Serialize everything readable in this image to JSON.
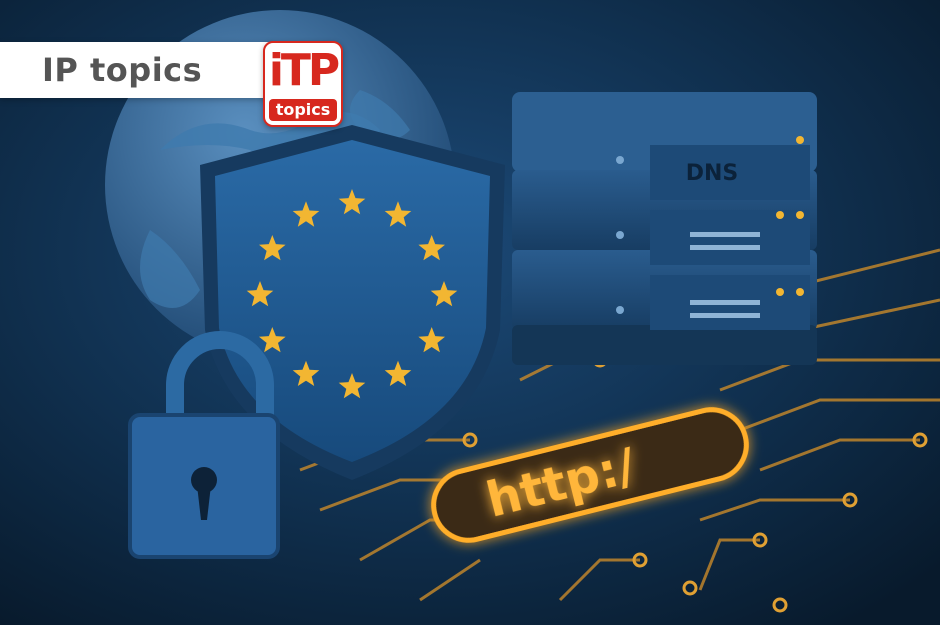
{
  "brand": {
    "title": "IP topics",
    "logo_mark": "iTP",
    "logo_word": "topics"
  },
  "scene": {
    "server_label": "DNS",
    "url_text": "http:/"
  },
  "colors": {
    "background": "#0b2138",
    "shield": "#1f5a93",
    "star": "#f2b632",
    "glow": "#ff9f1c",
    "server": "#1b4470",
    "brand_red": "#d7281e"
  }
}
